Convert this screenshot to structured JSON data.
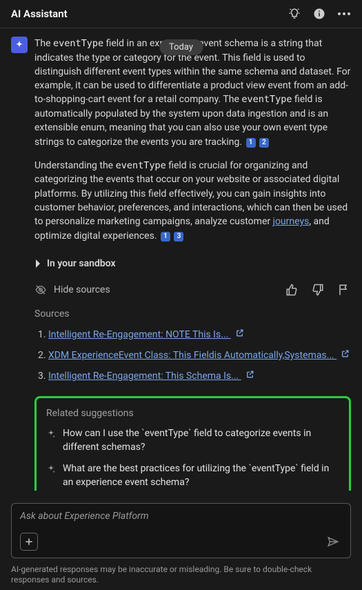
{
  "header": {
    "title": "AI Assistant"
  },
  "dateBadge": "Today",
  "message": {
    "p1_a": "The ",
    "p1_code1": "eventType",
    "p1_b": " field in an experience event schema is a string that indicates the type or category for the event. This field is used to distinguish different event types within the same schema and dataset. For example, it can be used to differentiate a product view event from an add-to-shopping-cart event for a retail company. The ",
    "p1_code2": "eventType",
    "p1_c": " field is automatically populated by the system upon data ingestion and is an extensible enum, meaning that you can also use your own event type strings to categorize the events you are tracking. ",
    "p1_cite1": "1",
    "p1_cite2": "2",
    "p2_a": "Understanding the ",
    "p2_code1": "eventType",
    "p2_b": " field is crucial for organizing and categorizing the events that occur on your website or associated digital platforms. By utilizing this field effectively, you can gain insights into customer behavior, preferences, and interactions, which can then be used to personalize marketing campaigns, analyze customer ",
    "p2_link": "journeys",
    "p2_c": ", and optimize digital experiences. ",
    "p2_cite1": "1",
    "p2_cite2": "3"
  },
  "sandboxLabel": "In your sandbox",
  "hideSourcesLabel": "Hide sources",
  "sourcesHeading": "Sources",
  "sources": [
    "Intelligent Re-Engagement: NOTE This Is... ",
    "XDM ExperienceEvent Class: This Fieldis Automatically,Systemas... ",
    "Intelligent Re-Engagement: This Schema Is... "
  ],
  "suggestionsHeading": "Related suggestions",
  "suggestions": [
    "How can I use the `eventType` field to categorize events in different schemas?",
    "What are the best practices for utilizing the `eventType` field in an experience event schema?"
  ],
  "input": {
    "placeholder": "Ask about Experience Platform"
  },
  "disclaimer": "AI-generated responses may be inaccurate or misleading. Be sure to double-check responses and sources."
}
